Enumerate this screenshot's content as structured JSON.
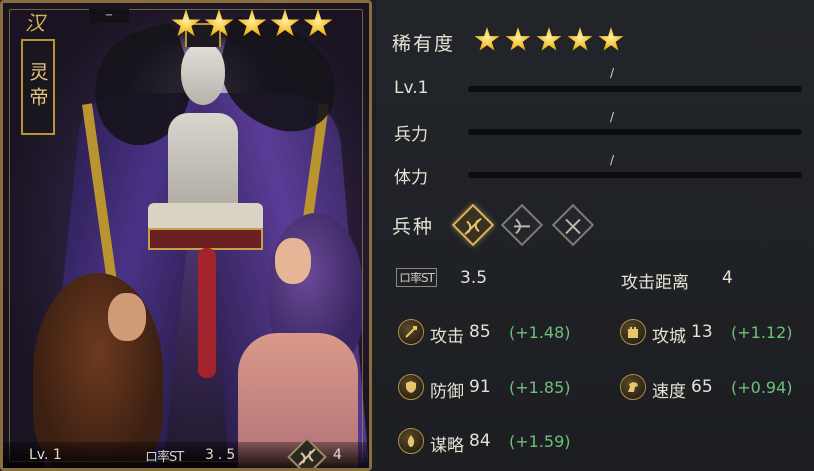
{
  "card": {
    "faction": "汉",
    "name": "灵帝",
    "stars": 5,
    "level": "Lv. 1",
    "rate_icon": "ロ率ST",
    "rate_value": "3.5",
    "range_value": "4",
    "troop_icon": "crossbow-icon"
  },
  "panel": {
    "rarity_label": "稀有度",
    "rarity_stars": 5,
    "level_label": "Lv.1",
    "troops_label": "兵力",
    "stamina_label": "体力",
    "bar_separator": "/",
    "troop_type_label": "兵种",
    "troop_types": [
      {
        "icon": "crossbow-icon",
        "active": true
      },
      {
        "icon": "bow-icon",
        "active": false
      },
      {
        "icon": "crossed-arrows-icon",
        "active": false
      }
    ],
    "rate_icon": "ロ率ST",
    "rate_value": "3.5",
    "range_label": "攻击距离",
    "range_value": "4",
    "stats": {
      "attack": {
        "icon": "sword-icon",
        "label": "攻击",
        "value": "85",
        "bonus": "(+1.48)"
      },
      "siege": {
        "icon": "tower-icon",
        "label": "攻城",
        "value": "13",
        "bonus": "(+1.12)"
      },
      "defense": {
        "icon": "shield-icon",
        "label": "防御",
        "value": "91",
        "bonus": "(+1.85)"
      },
      "speed": {
        "icon": "horse-icon",
        "label": "速度",
        "value": "65",
        "bonus": "(+0.94)"
      },
      "strategy": {
        "icon": "flame-icon",
        "label": "谋略",
        "value": "84",
        "bonus": "(+1.59)"
      }
    }
  },
  "colors": {
    "gold": "#d8b25a",
    "bonus_green": "#6fc07a",
    "panel_bg": "#1f2126"
  }
}
